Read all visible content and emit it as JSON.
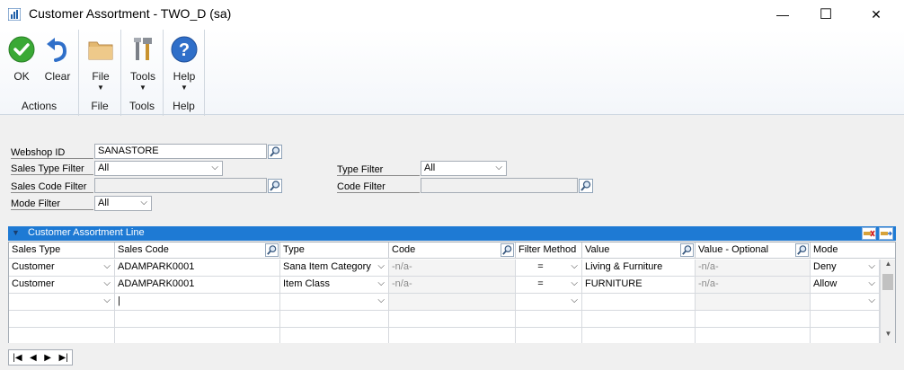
{
  "window": {
    "title": "Customer Assortment  -  TWO_D (sa)",
    "minimize_glyph": "—",
    "maximize_glyph": "☐",
    "close_glyph": "✕"
  },
  "ribbon": {
    "groups": [
      {
        "label": "Actions",
        "buttons": [
          {
            "label": "OK",
            "icon": "ok-check-icon"
          },
          {
            "label": "Clear",
            "icon": "undo-arrow-icon"
          }
        ]
      },
      {
        "label": "File",
        "buttons": [
          {
            "label": "File",
            "icon": "folder-icon"
          }
        ]
      },
      {
        "label": "Tools",
        "buttons": [
          {
            "label": "Tools",
            "icon": "tools-icon"
          }
        ]
      },
      {
        "label": "Help",
        "buttons": [
          {
            "label": "Help",
            "icon": "help-icon"
          }
        ]
      }
    ],
    "dropdown_glyph": "▼"
  },
  "form": {
    "webshop_id_label": "Webshop ID",
    "webshop_id_value": "SANASTORE",
    "sales_type_filter_label": "Sales Type Filter",
    "sales_type_filter_value": "All",
    "sales_code_filter_label": "Sales Code Filter",
    "sales_code_filter_value": "",
    "mode_filter_label": "Mode Filter",
    "mode_filter_value": "All",
    "type_filter_label": "Type Filter",
    "type_filter_value": "All",
    "code_filter_label": "Code Filter",
    "code_filter_value": ""
  },
  "grid": {
    "title": "Customer Assortment Line",
    "columns": [
      "Sales Type",
      "Sales Code",
      "Type",
      "Code",
      "Filter Method",
      "Value",
      "Value - Optional",
      "Mode"
    ],
    "rows": [
      {
        "sales_type": "Customer",
        "sales_code": "ADAMPARK0001",
        "type": "Sana Item Category",
        "code": "-n/a-",
        "filter_method": "=",
        "value": "Living & Furniture",
        "value_optional": "-n/a-",
        "mode": "Deny"
      },
      {
        "sales_type": "Customer",
        "sales_code": "ADAMPARK0001",
        "type": "Item Class",
        "code": "-n/a-",
        "filter_method": "=",
        "value": "FURNITURE",
        "value_optional": "-n/a-",
        "mode": "Allow"
      },
      {
        "sales_type": "",
        "sales_code": "|",
        "type": "",
        "code": "",
        "filter_method": "",
        "value": "",
        "value_optional": "",
        "mode": ""
      },
      {
        "sales_type": "",
        "sales_code": "",
        "type": "",
        "code": "",
        "filter_method": "",
        "value": "",
        "value_optional": "",
        "mode": ""
      }
    ]
  },
  "navigation": {
    "first": "|◀",
    "prev": "◀",
    "next": "▶",
    "last": "▶|"
  },
  "colors": {
    "grid_header": "#1e7ad4",
    "ok_green": "#3aa935",
    "help_blue": "#2f6fc9"
  }
}
